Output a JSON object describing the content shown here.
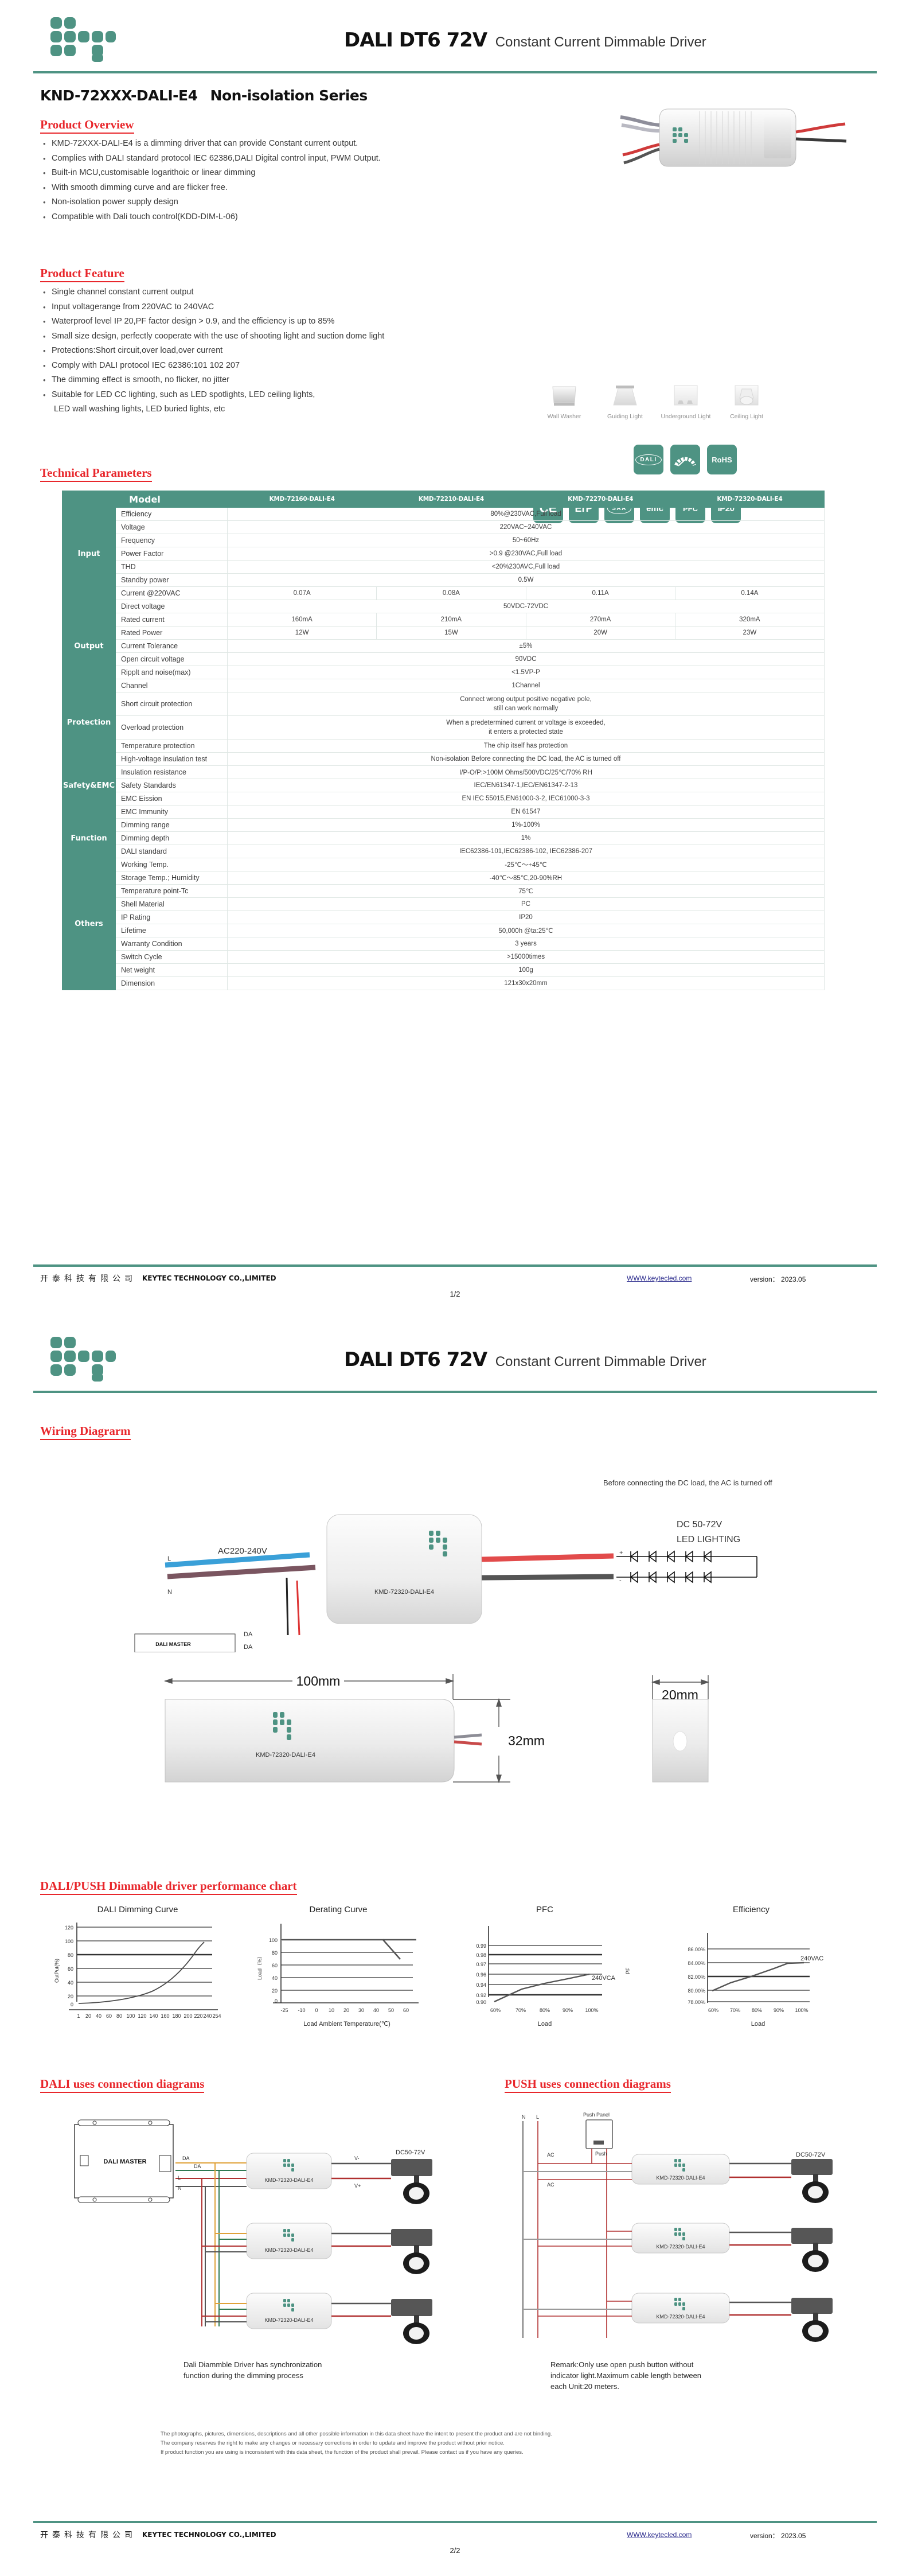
{
  "header": {
    "title_big": "DALI DT6  72V",
    "title_sub": "Constant Current Dimmable Driver",
    "logo_name": "keytec-logo"
  },
  "model_line": {
    "model": "KND-72XXX-DALI-E4",
    "series": "Non-isolation  Series"
  },
  "sections": {
    "product_overview": "Product Overview",
    "product_feature": "Product Feature",
    "technical_parameters": "Technical Parameters",
    "wiring_diagram": "Wiring Diagrarm",
    "performance_chart": "DALI/PUSH Dimmable driver  performance chart",
    "dali_connection": "DALI uses connection diagrams",
    "push_connection": "PUSH uses connection diagrams"
  },
  "overview_items": [
    "KMD-72XXX-DALI-E4  is a dimming driver that can provide  Constant current output.",
    "Complies with DALI standard protocol IEC 62386,DALI Digital control input, PWM  Output.",
    "Built-in MCU,customisable logarithoic or linear dimming",
    "With smooth dimming curve and are flicker free.",
    "Non-isolation power supply design",
    "Compatible with Dali touch control(KDD-DIM-L-06)"
  ],
  "feature_items": [
    "Single channel constant current output",
    "Input voltagerange from 220VAC to 240VAC",
    "Waterproof level IP 20,PF factor design > 0.9, and the efficiency is up to 85%",
    "Small size design, perfectly cooperate with the use of shooting light and suction dome light",
    "Protections:Short circuit,over load,over current",
    "Comply with DALI protocol IEC 62386:101 102 207",
    "The dimming effect is smooth, no flicker, no jitter",
    "Suitable for LED CC lighting, such as LED spotlights, LED ceiling lights,",
    "LED wall washing lights, LED buried lights, etc"
  ],
  "applications": [
    {
      "label": "Wall Washer",
      "icon": "wall-washer-icon"
    },
    {
      "label": "Guiding Light",
      "icon": "guiding-light-icon"
    },
    {
      "label": "Underground Light",
      "icon": "underground-light-icon"
    },
    {
      "label": "Ceiling Light",
      "icon": "ceiling-light-icon"
    }
  ],
  "certs_row1": [
    {
      "label": "DALI",
      "icon": "dali-badge"
    },
    {
      "label": "Energy",
      "icon": "energy-efficiency-badge"
    },
    {
      "label": "RoHS",
      "icon": "rohs-badge"
    }
  ],
  "certs_row2": [
    {
      "label": "CE",
      "icon": "ce-badge"
    },
    {
      "label": "ErP",
      "icon": "erp-badge"
    },
    {
      "label": "SAA",
      "icon": "saa-badge"
    },
    {
      "label": "emc",
      "icon": "emc-badge"
    },
    {
      "label": "PFC",
      "icon": "pfc-badge"
    },
    {
      "label": "IP20",
      "icon": "ip20-badge"
    }
  ],
  "spec_table": {
    "model_header": "Model",
    "models": [
      "KMD-72160-DALI-E4",
      "KMD-72210-DALI-E4",
      "KMD-72270-DALI-E4",
      "KMD-72320-DALI-E4"
    ],
    "groups": [
      {
        "name": "Input",
        "rows": [
          {
            "label": "Efficiency",
            "span": "80%@230VAC,Full load"
          },
          {
            "label": "Voltage",
            "span": "220VAC~240VAC"
          },
          {
            "label": "Frequency",
            "span": "50~60Hz"
          },
          {
            "label": "Power Factor",
            "span": ">0.9 @230VAC,Full load"
          },
          {
            "label": "THD",
            "span": "<20%230AVC,Full load"
          },
          {
            "label": "Standby power",
            "span": "0.5W"
          },
          {
            "label": "Current @220VAC",
            "cells": [
              "0.07A",
              "0.08A",
              "0.11A",
              "0.14A"
            ]
          }
        ]
      },
      {
        "name": "Output",
        "rows": [
          {
            "label": "Direct voltage",
            "span": "50VDC-72VDC"
          },
          {
            "label": "Rated current",
            "cells": [
              "160mA",
              "210mA",
              "270mA",
              "320mA"
            ]
          },
          {
            "label": "Rated Power",
            "cells": [
              "12W",
              "15W",
              "20W",
              "23W"
            ]
          },
          {
            "label": "Current Tolerance",
            "span": "±5%"
          },
          {
            "label": "Open circuit voltage",
            "span": "90VDC"
          },
          {
            "label": "Ripplt and noise(max)",
            "span": "<1.5VP-P"
          },
          {
            "label": "Channel",
            "span": "1Channel"
          }
        ]
      },
      {
        "name": "Protection",
        "rows": [
          {
            "label": "Short circuit protection",
            "span": "Connect wrong output positive negative pole,\nstill can work normally",
            "two": true
          },
          {
            "label": "Overload protection",
            "span": "When a predetermined current or voltage is exceeded,\nit enters a protected state",
            "two": true
          },
          {
            "label": "Temperature protection",
            "span": "The chip itself has protection"
          }
        ]
      },
      {
        "name": "Safety&EMC",
        "rows": [
          {
            "label": "High-voltage insulation test",
            "span": "Non-isolation  Before connecting the DC load, the AC is turned off"
          },
          {
            "label": "Insulation resistance",
            "span": "I/P-O/P:>100M Ohms/500VDC/25℃/70% RH"
          },
          {
            "label": "Safety Standards",
            "span": "IEC/EN61347-1,IEC/EN61347-2-13"
          },
          {
            "label": "EMC Eission",
            "span": "EN IEC 55015,EN61000-3-2, IEC61000-3-3"
          },
          {
            "label": "EMC Immunity",
            "span": "EN 61547"
          }
        ]
      },
      {
        "name": "Function",
        "rows": [
          {
            "label": "Dimming range",
            "span": "1%-100%"
          },
          {
            "label": "Dimming depth",
            "span": "1%"
          },
          {
            "label": "DALI standard",
            "span": "IEC62386-101,IEC62386-102, IEC62386-207"
          }
        ]
      },
      {
        "name": "Others",
        "rows": [
          {
            "label": "Working Temp.",
            "span": "-25℃～+45℃"
          },
          {
            "label": "Storage Temp.; Humidity",
            "span": "-40℃～85℃,20-90%RH"
          },
          {
            "label": "Temperature point-Tc",
            "span": "75℃"
          },
          {
            "label": "Shell Material",
            "span": "PC"
          },
          {
            "label": "IP Rating",
            "span": "IP20"
          },
          {
            "label": "Lifetime",
            "span": "50,000h @ta:25℃"
          },
          {
            "label": "Warranty Condition",
            "span": "3 years"
          },
          {
            "label": "Switch Cycle",
            "span": ">15000times"
          },
          {
            "label": "Net weight",
            "span": "100g"
          },
          {
            "label": "Dimension",
            "span": "121x30x20mm"
          }
        ]
      }
    ]
  },
  "footer": {
    "company_cn": "开泰科技有限公司",
    "company_en": "KEYTEC TECHNOLOGY CO.,LIMITED",
    "url": "WWW.keytecled.com",
    "version": "version： 2023.05",
    "page1": "1/2",
    "page2": "2/2"
  },
  "wiring": {
    "note": "Before connecting the DC load, the AC is turned off",
    "ac_label": "AC220-240V",
    "l_label": "L",
    "n_label": "N",
    "da_label_1": "DA",
    "da_label_2": "DA",
    "dali_master": "DALI MASTER",
    "driver_model": "KMD-72320-DALI-E4",
    "dc_label": "DC 50-72V",
    "led_label": "LED LIGHTING",
    "plus": "+",
    "minus": "-"
  },
  "dimensions": {
    "length": "100mm",
    "height": "32mm",
    "depth": "20mm",
    "model": "KMD-72320-DALI-E4"
  },
  "chart_data": [
    {
      "type": "line",
      "title": "DALI Dimming Curve",
      "xlabel": "",
      "ylabel": "OutPut(%)",
      "x": [
        1,
        20,
        40,
        60,
        80,
        100,
        120,
        140,
        160,
        180,
        200,
        220,
        240,
        254
      ],
      "values": [
        0.3,
        0.5,
        0.9,
        1.6,
        2.8,
        4.6,
        7.5,
        11.5,
        16.5,
        22,
        33,
        48,
        73,
        100
      ],
      "xticks": [
        "1",
        "20",
        "40",
        "60",
        "80",
        "100",
        "120",
        "140",
        "160",
        "180",
        "200",
        "220",
        "240",
        "254"
      ],
      "yticks": [
        "0",
        "20",
        "40",
        "60",
        "80",
        "100",
        "120"
      ],
      "ylim": [
        0,
        120
      ],
      "grid": true,
      "legend": ""
    },
    {
      "type": "line",
      "title": "Derating Curve",
      "xlabel": "Load Ambient Temperature(℃)",
      "ylabel": "Load（%）",
      "x": [
        -25,
        -10,
        0,
        10,
        20,
        30,
        40,
        45,
        50,
        55,
        60
      ],
      "values": [
        100,
        100,
        100,
        100,
        100,
        100,
        100,
        100,
        84,
        68,
        68
      ],
      "xticks": [
        "-25",
        "-10",
        "0",
        "10",
        "20",
        "30",
        "40",
        "50",
        "60"
      ],
      "yticks": [
        "0",
        "20",
        "40",
        "60",
        "80",
        "100"
      ],
      "ylim": [
        0,
        110
      ],
      "grid": true,
      "legend": ""
    },
    {
      "type": "line",
      "title": "PFC",
      "xlabel": "Load",
      "ylabel": "PF",
      "x": [
        "60%",
        "70%",
        "80%",
        "90%",
        "100%"
      ],
      "values": [
        0.9,
        0.925,
        0.938,
        0.948,
        0.957
      ],
      "xticks": [
        "60%",
        "70%",
        "80%",
        "90%",
        "100%"
      ],
      "yticks": [
        "0.90",
        "0.92",
        "0.94",
        "0.96",
        "0.97",
        "0.98",
        "0.99"
      ],
      "ylim": [
        0.9,
        1.0
      ],
      "grid": true,
      "legend": "240VCA"
    },
    {
      "type": "line",
      "title": "Efficiency",
      "xlabel": "Load",
      "ylabel": "",
      "x": [
        "60%",
        "70%",
        "80%",
        "90%",
        "100%"
      ],
      "values": [
        80.2,
        81.6,
        82.8,
        83.8,
        84.1
      ],
      "xticks": [
        "60%",
        "70%",
        "80%",
        "90%",
        "100%"
      ],
      "yticks": [
        "78.00%",
        "80.00%",
        "82.00%",
        "84.00%",
        "86.00%"
      ],
      "ylim": [
        78,
        87
      ],
      "grid": true,
      "legend": "240VAC"
    }
  ],
  "dali_diagram": {
    "master_label": "DALI MASTER",
    "da1": "DA",
    "da2": "DA",
    "l": "L",
    "n": "N",
    "drivers": [
      "KMD-72320-DALI-E4",
      "KMD-72320-DALI-E4",
      "KMD-72320-DALI-E4"
    ],
    "vminus": "V-",
    "vplus": "V+",
    "dc": "DC50-72V",
    "caption": "Dali Diammble Driver has synchronization\nfunction during the dimming process"
  },
  "push_diagram": {
    "n": "N",
    "l": "L",
    "ac1": "AC",
    "ac2": "AC",
    "push": "Push",
    "push_panel": "Push Panel",
    "drivers": [
      "KMD-72320-DALI-E4",
      "KMD-72320-DALI-E4",
      "KMD-72320-DALI-E4"
    ],
    "dc": "DC50-72V",
    "caption": "Remark:Only use open push button without\nindicator light.Maximum cable length between\neach Unit:20 meters."
  },
  "disclaimer": [
    "The photographs, pictures, dimensions, descriptions and all other possible information in this data sheet have the intent to present the product and are not binding.",
    "The company reserves the right to make any changes or necessary corrections in order to update and improve the product without prior notice.",
    "If product function you are using is inconsistent with this data sheet, the function of the product shall prevail. Please contact us if you have any queries."
  ],
  "colors": {
    "brand_green": "#4e9383",
    "heading_red": "#e8272c"
  }
}
